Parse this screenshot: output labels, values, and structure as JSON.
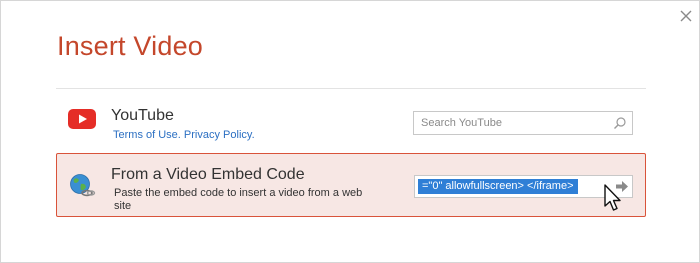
{
  "dialog": {
    "title": "Insert Video",
    "close_icon": "close-icon"
  },
  "youtube": {
    "icon": "youtube-icon",
    "name": "YouTube",
    "terms_label": "Terms of Use.",
    "privacy_label": "Privacy Policy.",
    "search_placeholder": "Search YouTube",
    "search_icon": "search-icon"
  },
  "embed": {
    "icon": "globe-icon",
    "name": "From a Video Embed Code",
    "description": "Paste the embed code to insert a video from a web site",
    "input_value": "=\"0\" allowfullscreen> </iframe>",
    "submit_icon": "arrow-right-icon"
  },
  "colors": {
    "title": "#c4472b",
    "selected_border": "#d9533a",
    "selected_background": "#f7e7e4",
    "link": "#2b6fc2",
    "selection": "#2f7fd6",
    "youtube_red": "#e52d27"
  },
  "cursor_icon": "mouse-pointer-icon"
}
